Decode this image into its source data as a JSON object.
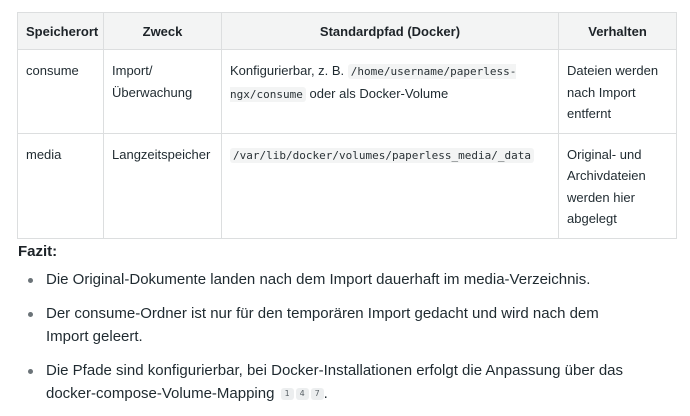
{
  "table": {
    "headers": [
      "Speicherort",
      "Zweck",
      "Standardpfad (Docker)",
      "Verhalten"
    ],
    "rows": [
      {
        "location": "consume",
        "purpose": "Import/ Überwachung",
        "path_prefix": "Konfigurierbar, z. B.",
        "path_code": "/home/username/paperless-ngx/consume",
        "path_suffix": "oder als Docker-Volume",
        "behavior": "Dateien werden nach Import entfernt"
      },
      {
        "location": "media",
        "purpose": "Langzeitspeicher",
        "path_code": "/var/lib/docker/volumes/paperless_media/_data",
        "behavior": "Original- und Archivdateien werden hier abgelegt"
      }
    ]
  },
  "summary": {
    "heading": "Fazit:",
    "bullets": [
      {
        "text": "Die Original-Dokumente landen nach dem Import dauerhaft im media-Verzeichnis."
      },
      {
        "text": "Der consume-Ordner ist nur für den temporären Import gedacht und wird nach dem Import geleert."
      },
      {
        "text": "Die Pfade sind konfigurierbar, bei Docker-Installationen erfolgt die Anpassung über das docker-compose-Volume-Mapping",
        "citations": [
          "1",
          "4",
          "7"
        ],
        "end": "."
      }
    ]
  }
}
